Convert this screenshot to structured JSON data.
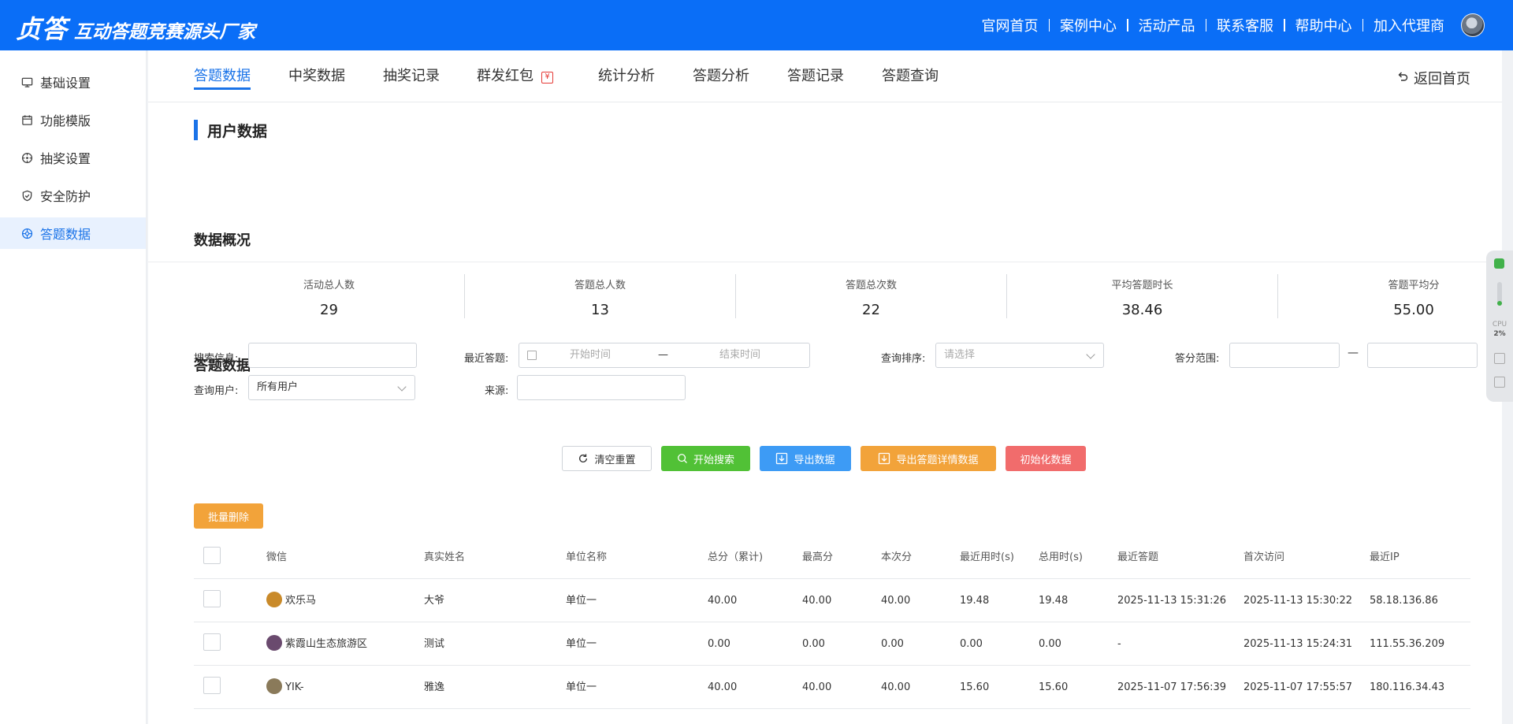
{
  "header": {
    "brand": "贞答",
    "slogan": "互动答题竞赛源头厂家",
    "nav": [
      "官网首页",
      "案例中心",
      "活动产品",
      "联系客服",
      "帮助中心",
      "加入代理商"
    ]
  },
  "sidebar": {
    "items": [
      {
        "label": "基础设置",
        "icon": "monitor-icon"
      },
      {
        "label": "功能模版",
        "icon": "calendar-icon"
      },
      {
        "label": "抽奖设置",
        "icon": "lottery-icon"
      },
      {
        "label": "安全防护",
        "icon": "shield-icon"
      },
      {
        "label": "答题数据",
        "icon": "chart-icon",
        "active": true
      }
    ]
  },
  "tabs": [
    "答题数据",
    "中奖数据",
    "抽奖记录",
    "群发红包",
    "统计分析",
    "题分析",
    "答题记录",
    "答题查询"
  ],
  "tab_labels": {
    "t0": "答题数据",
    "t1": "中奖数据",
    "t2": "抽奖记录",
    "t3": "群发红包",
    "t4": "统计分析",
    "t5": "答题分析",
    "t6": "答题记录",
    "t7": "答题查询"
  },
  "red_packet_badge": "¥",
  "back_home": "返回首页",
  "page": {
    "section_title": "用户数据",
    "overview_title": "数据概况",
    "data_title": "答题数据"
  },
  "stats": [
    {
      "label": "活动总人数",
      "value": "29"
    },
    {
      "label": "答题总人数",
      "value": "13"
    },
    {
      "label": "答题总次数",
      "value": "22"
    },
    {
      "label": "平均答题时长",
      "value": "38.46"
    },
    {
      "label": "答题平均分",
      "value": "55.00"
    }
  ],
  "filters": {
    "search_label": "搜索信息:",
    "search_value": "",
    "recent_label": "最近答题:",
    "start_placeholder": "开始时间",
    "range_dash": "—",
    "end_placeholder": "结束时间",
    "sort_label": "查询排序:",
    "sort_placeholder": "请选择",
    "score_label": "答分范围:",
    "score_dash": "—",
    "user_label": "查询用户:",
    "user_value": "所有用户",
    "source_label": "来源:",
    "source_value": ""
  },
  "actions": {
    "reset": "清空重置",
    "search": "开始搜索",
    "export": "导出数据",
    "export_detail": "导出答题详情数据",
    "init": "初始化数据",
    "batch_delete": "批量删除"
  },
  "table": {
    "columns": [
      "微信",
      "真实姓名",
      "单位名称",
      "总分（累计)",
      "最高分",
      "本次分",
      "最近用时(s)",
      "总用时(s)",
      "最近答题",
      "首次访问",
      "最近IP"
    ],
    "rows": [
      {
        "wechat": "欢乐马",
        "name": "大爷",
        "unit": "单位一",
        "total": "40.00",
        "max": "40.00",
        "current": "40.00",
        "recent_time": "19.48",
        "total_time": "19.48",
        "recent_answer": "2025-11-13 15:31:26",
        "first_visit": "2025-11-13 15:30:22",
        "ip": "58.18.136.86",
        "avatar_color": "#c98a2a"
      },
      {
        "wechat": "紫霞山生态旅游区",
        "name": "测试",
        "unit": "单位一",
        "total": "0.00",
        "max": "0.00",
        "current": "0.00",
        "recent_time": "0.00",
        "total_time": "0.00",
        "recent_answer": "-",
        "first_visit": "2025-11-13 15:24:31",
        "ip": "111.55.36.209",
        "avatar_color": "#6a4a6e"
      },
      {
        "wechat": "YIK-",
        "name": "雅逸",
        "unit": "单位一",
        "total": "40.00",
        "max": "40.00",
        "current": "40.00",
        "recent_time": "15.60",
        "total_time": "15.60",
        "recent_answer": "2025-11-07 17:56:39",
        "first_visit": "2025-11-07 17:55:57",
        "ip": "180.116.34.43",
        "avatar_color": "#8a7a5a"
      }
    ]
  },
  "widget": {
    "cpu_label": "CPU",
    "cpu_value": "2%"
  },
  "colors": {
    "header_bg": "#0a6ef7",
    "accent": "#1a73e8",
    "green": "#51c136",
    "blue": "#3d9bf5",
    "orange": "#f2a33a",
    "red": "#f16c6c"
  }
}
